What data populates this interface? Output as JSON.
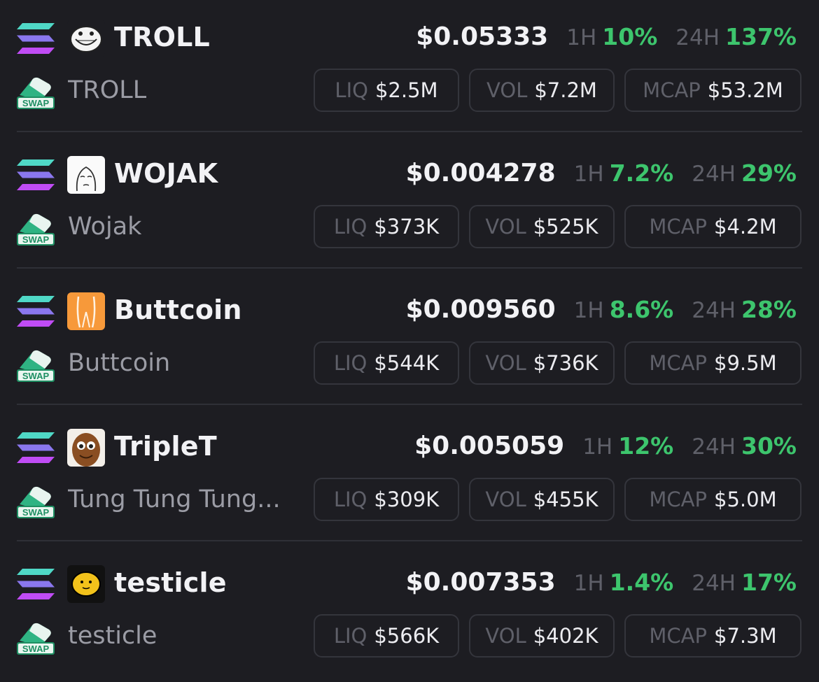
{
  "colors": {
    "background": "#1d1d22",
    "positive": "#3dc56d",
    "muted_label": "#5f6069",
    "border": "#34353c"
  },
  "icons": {
    "chain": "solana-logo-icon",
    "swap": "swap-eraser-icon",
    "swap_badge_text": "SWAP"
  },
  "labels": {
    "h1": "1H",
    "h24": "24H",
    "liq": "LIQ",
    "vol": "VOL",
    "mcap": "MCAP"
  },
  "tokens": [
    {
      "symbol": "TROLL",
      "name": "TROLL",
      "icon": "trollface-icon",
      "price": "$0.05333",
      "change_1h": "10%",
      "change_24h": "137%",
      "liq": "$2.5M",
      "vol": "$7.2M",
      "mcap": "$53.2M"
    },
    {
      "symbol": "WOJAK",
      "name": "Wojak",
      "icon": "wojak-icon",
      "price": "$0.004278",
      "change_1h": "7.2%",
      "change_24h": "29%",
      "liq": "$373K",
      "vol": "$525K",
      "mcap": "$4.2M"
    },
    {
      "symbol": "Buttcoin",
      "name": "Buttcoin",
      "icon": "buttcoin-icon",
      "price": "$0.009560",
      "change_1h": "8.6%",
      "change_24h": "28%",
      "liq": "$544K",
      "vol": "$736K",
      "mcap": "$9.5M"
    },
    {
      "symbol": "TripleT",
      "name": "Tung Tung Tung...",
      "icon": "tung-tung-tung-icon",
      "price": "$0.005059",
      "change_1h": "12%",
      "change_24h": "30%",
      "liq": "$309K",
      "vol": "$455K",
      "mcap": "$5.0M"
    },
    {
      "symbol": "testicle",
      "name": "testicle",
      "icon": "testicle-icon",
      "price": "$0.007353",
      "change_1h": "1.4%",
      "change_24h": "17%",
      "liq": "$566K",
      "vol": "$402K",
      "mcap": "$7.3M"
    }
  ]
}
